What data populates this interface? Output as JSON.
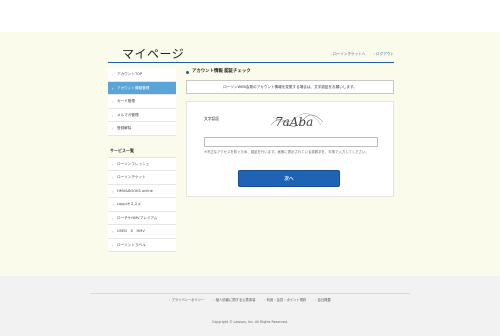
{
  "header": {
    "page_title": "マイページ",
    "links": [
      "ローソンチケットへ",
      "ログアウト"
    ]
  },
  "sidebar": {
    "items": [
      "アカウントTOP",
      "アカウント情報管理",
      "カード管理",
      "メルマガ管理",
      "登録解除"
    ],
    "service_heading": "サービス一覧",
    "services": [
      "ローソンフレッシュ",
      "ローソンチケット",
      "HMV&BOOKS online",
      "Loppiオススメ",
      "ローチケHMVプレミアム",
      "USEN　X　HMV",
      "ローソントラベル"
    ]
  },
  "main": {
    "section_title": "アカウント情報 認証チェック",
    "notice": "ローソンWEB会員のアカウント情報を変更する場合は、文字認証をお願いします。",
    "captcha_label": "文字認証",
    "captcha_text": "7aAba",
    "input_placeholder": "",
    "note": "※不正なアクセスを防ぐため、認証を行います。画像に表示されている英数字を、半角で入力してください。",
    "next_button": "次へ"
  },
  "footer": {
    "links": [
      "プライバシーポリシー",
      "個人情報に関する公表事項",
      "利用・会員・ポイント規約",
      "会社概要"
    ],
    "copyright": "Copyright © Lawson, Inc. All Rights Reserved."
  },
  "colors": {
    "accent": "#1f63b5",
    "sidebar_active": "#5aa5d8",
    "main_bg": "#fbfbec"
  }
}
